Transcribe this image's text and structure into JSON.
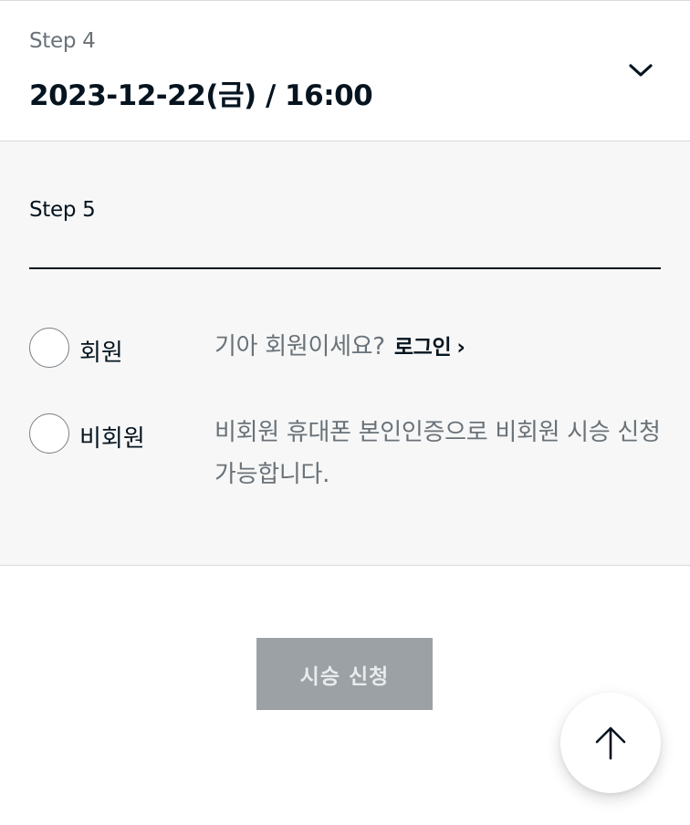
{
  "step4": {
    "label": "Step 4",
    "value": "2023-12-22(금) / 16:00",
    "toggle_icon": "chevron-down-icon"
  },
  "step5": {
    "label": "Step 5",
    "options": [
      {
        "label": "회원",
        "description": "기아 회원이세요?",
        "link_label": "로그인",
        "link_icon": "chevron-right-icon",
        "selected": false
      },
      {
        "label": "비회원",
        "description": "비회원 휴대폰 본인인증으로 비회원 시승 신청 가능합니다.",
        "selected": false
      }
    ]
  },
  "apply_button": {
    "label": "시승 신청",
    "disabled": true
  },
  "scroll_top": {
    "icon": "arrow-up-icon"
  },
  "colors": {
    "text_primary": "#05141f",
    "text_secondary": "#697278",
    "section_bg": "#f7f7f7",
    "button_disabled_bg": "#9ba1a5"
  }
}
